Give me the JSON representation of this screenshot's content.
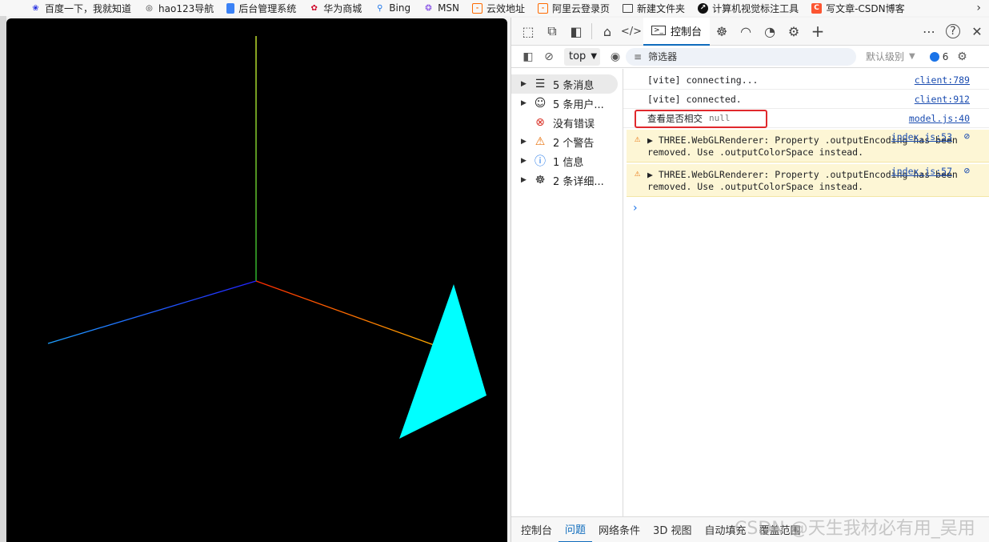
{
  "bookmarks": [
    {
      "label": "百度一下，我就知道",
      "icon": "paw-icon",
      "color": "#2932e1"
    },
    {
      "label": "hao123导航",
      "icon": "globe-icon",
      "color": "#333333"
    },
    {
      "label": "后台管理系统",
      "icon": "doc-icon",
      "color": "#3b82f6"
    },
    {
      "label": "华为商城",
      "icon": "huawei-icon",
      "color": "#cf0a2c"
    },
    {
      "label": "Bing",
      "icon": "search-icon",
      "color": "#1a73e8"
    },
    {
      "label": "MSN",
      "icon": "butterfly-icon",
      "color": "#7b3fe4"
    },
    {
      "label": "云效地址",
      "icon": "bracket-icon",
      "color": "#ff6a00"
    },
    {
      "label": "阿里云登录页",
      "icon": "bracket-icon",
      "color": "#ff6a00"
    },
    {
      "label": "新建文件夹",
      "icon": "folder-icon",
      "color": "#444444"
    },
    {
      "label": "计算机视觉标注工具",
      "icon": "arrow-circle-icon",
      "color": "#111111"
    },
    {
      "label": "写文章-CSDN博客",
      "icon": "csdn-icon",
      "color": "#fc5531"
    }
  ],
  "devtools": {
    "active_tab": "控制台",
    "toolbar": {
      "context": "top",
      "filter_placeholder": "筛选器",
      "levels": "默认级别",
      "issue_count": "6"
    },
    "sidebar": [
      {
        "label": "5 条消息",
        "icon": "list-icon",
        "expandable": true,
        "selected": true
      },
      {
        "label": "5 条用户...",
        "icon": "user-icon",
        "expandable": true
      },
      {
        "label": "没有错误",
        "icon": "error-icon",
        "expandable": false
      },
      {
        "label": "2 个警告",
        "icon": "warning-icon",
        "expandable": true
      },
      {
        "label": "1 信息",
        "icon": "info-icon",
        "expandable": true
      },
      {
        "label": "2 条详细...",
        "icon": "bug-icon",
        "expandable": true
      }
    ],
    "console": {
      "lines": [
        {
          "text": "[vite] connecting...",
          "source": "client:789"
        },
        {
          "text": "[vite] connected.",
          "source": "client:912"
        },
        {
          "text": "查看是否相交",
          "value": "null",
          "source": "model.js:40"
        }
      ],
      "warnings": [
        {
          "text": "THREE.WebGLRenderer: Property .outputEncoding has been removed. Use .outputColorSpace instead.",
          "source": "index.js:53"
        },
        {
          "text": "THREE.WebGLRenderer: Property .outputEncoding has been removed. Use .outputColorSpace instead.",
          "source": "index.js:57"
        }
      ]
    },
    "bottom_tabs": [
      "控制台",
      "问题",
      "网络条件",
      "3D 视图",
      "自动填充",
      "覆盖范围"
    ],
    "bottom_active": "问题"
  },
  "scene": {
    "background": "#000000",
    "triangle_color": "#00ffff"
  },
  "watermark": "CSDN @天生我材必有用_吴用"
}
